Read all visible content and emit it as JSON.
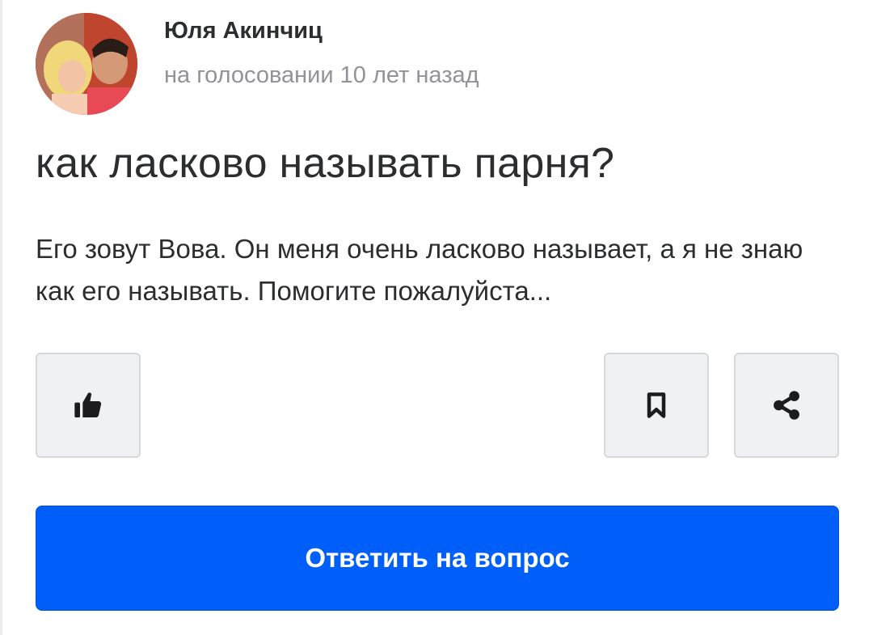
{
  "author": {
    "name": "Юля Акинчиц",
    "meta": "на голосовании 10 лет назад"
  },
  "question": {
    "title": "как ласково называть парня?",
    "body": "Его зовут Вова. Он меня очень ласково называет, а я не знаю как его называть. Помогите пожалуйста..."
  },
  "actions": {
    "like_icon": "thumbs-up-icon",
    "bookmark_icon": "bookmark-icon",
    "share_icon": "share-icon",
    "answer_label": "Ответить на вопрос"
  },
  "colors": {
    "accent": "#005ff9",
    "text": "#2c2d2e",
    "muted": "#919399",
    "button_bg": "#f0f1f3",
    "button_border": "#d7d8db"
  }
}
